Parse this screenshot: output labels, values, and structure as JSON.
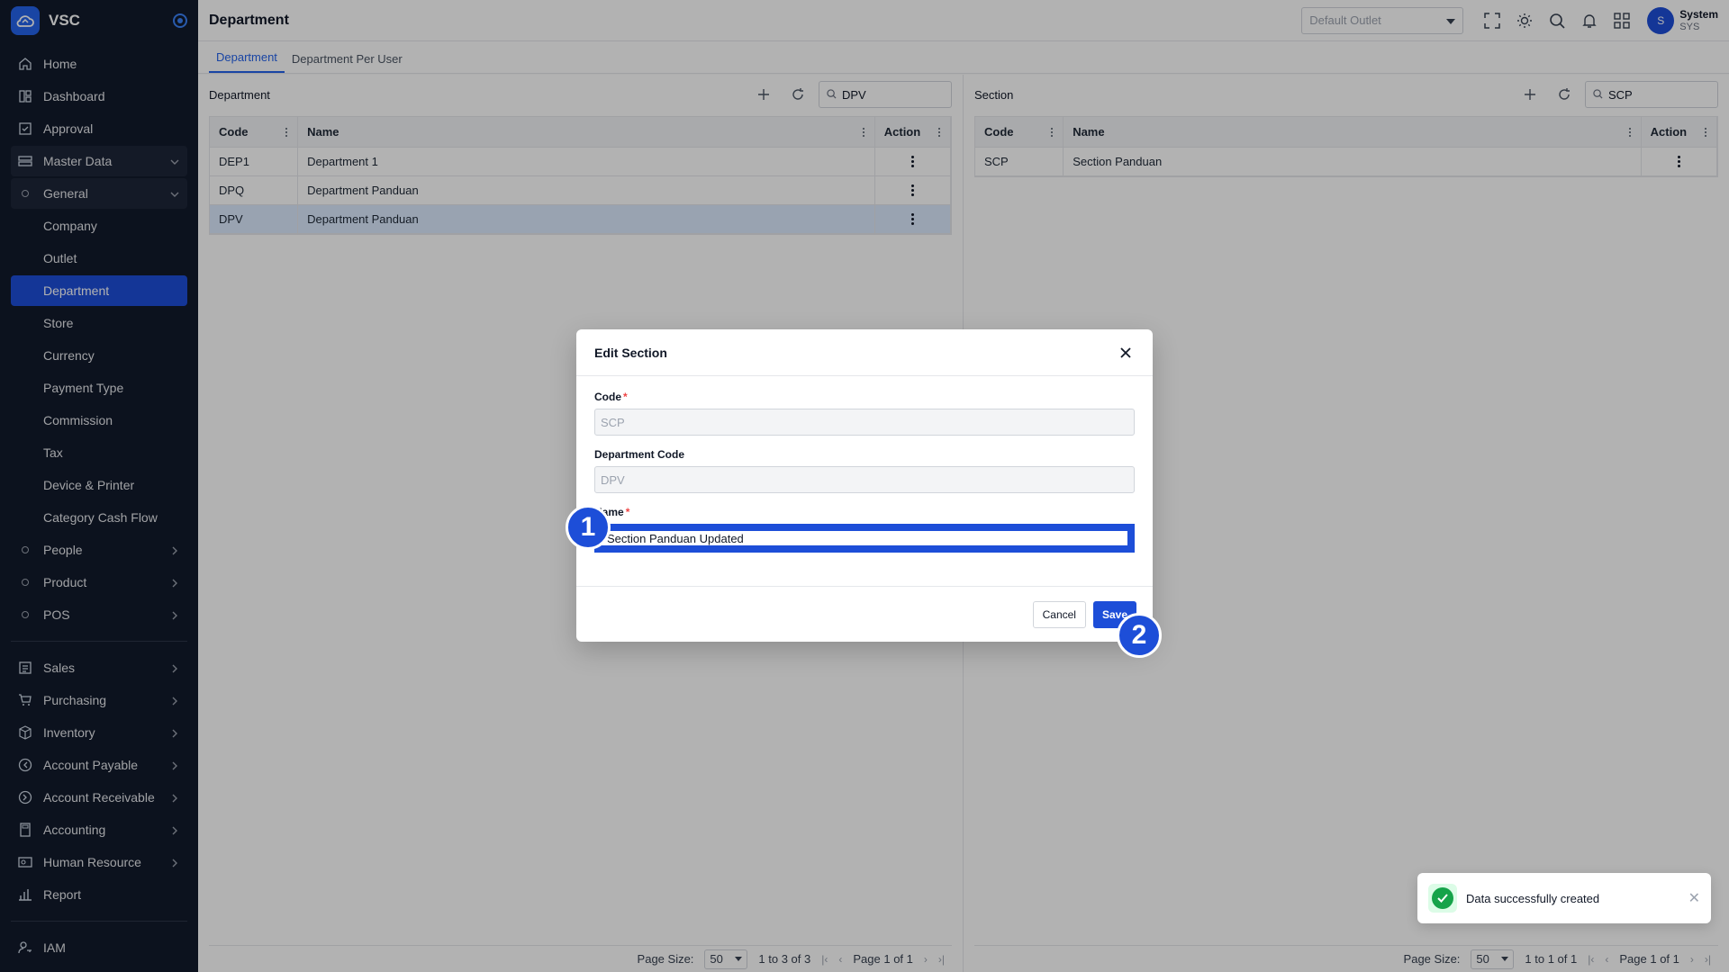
{
  "brand": {
    "name": "VSC"
  },
  "sidebar": {
    "items": [
      {
        "label": "Home",
        "icon": "home-icon"
      },
      {
        "label": "Dashboard",
        "icon": "dashboard-icon"
      },
      {
        "label": "Approval",
        "icon": "approval-icon"
      },
      {
        "label": "Master Data",
        "icon": "database-icon"
      },
      {
        "label": "General",
        "icon": "circle-icon"
      },
      {
        "label": "Company"
      },
      {
        "label": "Outlet"
      },
      {
        "label": "Department"
      },
      {
        "label": "Store"
      },
      {
        "label": "Currency"
      },
      {
        "label": "Payment Type"
      },
      {
        "label": "Commission"
      },
      {
        "label": "Tax"
      },
      {
        "label": "Device & Printer"
      },
      {
        "label": "Category Cash Flow"
      },
      {
        "label": "People",
        "icon": "circle-icon"
      },
      {
        "label": "Product",
        "icon": "circle-icon"
      },
      {
        "label": "POS",
        "icon": "circle-icon"
      },
      {
        "label": "Sales",
        "icon": "sales-icon"
      },
      {
        "label": "Purchasing",
        "icon": "cart-icon"
      },
      {
        "label": "Inventory",
        "icon": "box-icon"
      },
      {
        "label": "Account Payable",
        "icon": "payable-icon"
      },
      {
        "label": "Account Receivable",
        "icon": "receivable-icon"
      },
      {
        "label": "Accounting",
        "icon": "calculator-icon"
      },
      {
        "label": "Human Resource",
        "icon": "id-card-icon"
      },
      {
        "label": "Report",
        "icon": "chart-icon"
      },
      {
        "label": "IAM",
        "icon": "user-key-icon"
      }
    ]
  },
  "header": {
    "title": "Department",
    "outlet_placeholder": "Default Outlet",
    "user_name": "System",
    "user_code": "SYS",
    "avatar_initial": "S"
  },
  "tabs": [
    "Department",
    "Department Per User"
  ],
  "department_panel": {
    "title": "Department",
    "search_value": "DPV",
    "columns": [
      "Code",
      "Name",
      "Action"
    ],
    "rows": [
      {
        "code": "DEP1",
        "name": "Department 1"
      },
      {
        "code": "DPQ",
        "name": "Department Panduan"
      },
      {
        "code": "DPV",
        "name": "Department Panduan"
      }
    ],
    "pager": {
      "page_size_label": "Page Size:",
      "page_size": "50",
      "range": "1 to 3 of 3",
      "page_text": "Page 1 of 1"
    }
  },
  "section_panel": {
    "title": "Section",
    "search_value": "SCP",
    "columns": [
      "Code",
      "Name",
      "Action"
    ],
    "rows": [
      {
        "code": "SCP",
        "name": "Section Panduan"
      }
    ],
    "pager": {
      "page_size_label": "Page Size:",
      "page_size": "50",
      "range": "1 to 1 of 1",
      "page_text": "Page 1 of 1"
    }
  },
  "modal": {
    "title": "Edit Section",
    "fields": {
      "code_label": "Code",
      "code_value": "SCP",
      "dept_label": "Department Code",
      "dept_value": "DPV",
      "name_label": "Name",
      "name_value": "Section Panduan Updated"
    },
    "cancel_label": "Cancel",
    "save_label": "Save"
  },
  "markers": [
    "1",
    "2"
  ],
  "toast": {
    "message": "Data successfully created"
  },
  "colors": {
    "primary": "#1d4ed8",
    "sidebar_bg": "#121a2c",
    "success": "#16a34a"
  }
}
